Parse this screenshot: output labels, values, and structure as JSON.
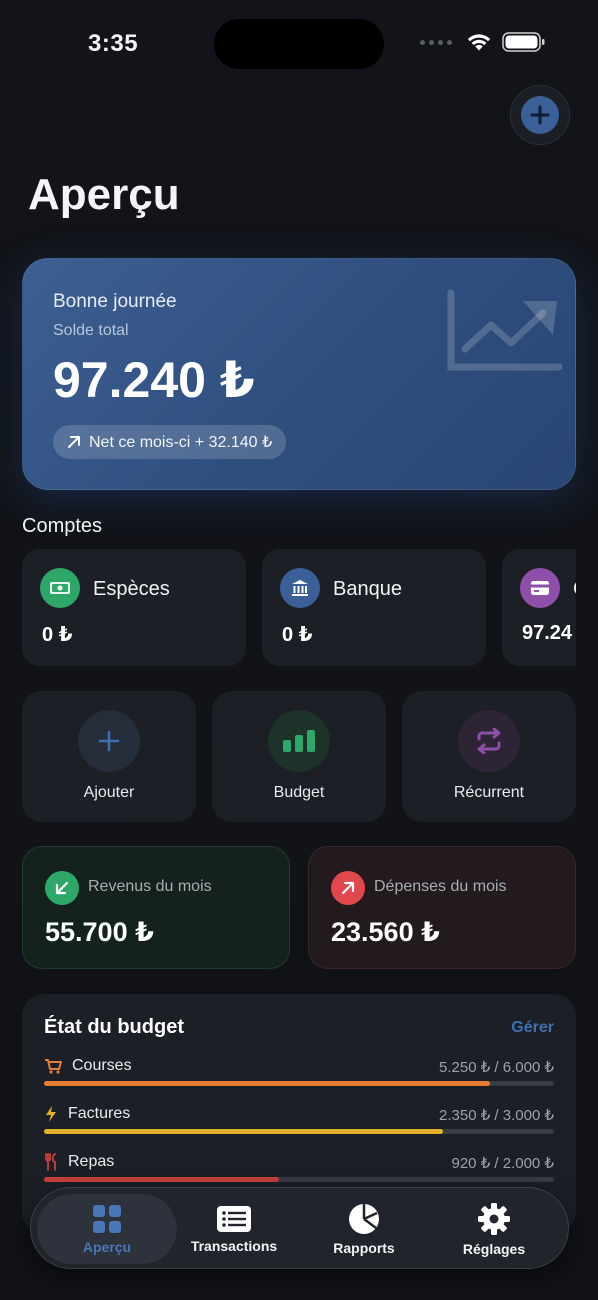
{
  "status": {
    "time": "3:35"
  },
  "header": {
    "title": "Aperçu"
  },
  "balance": {
    "greeting": "Bonne journée",
    "label": "Solde total",
    "value": "97.240 ₺",
    "net": "Net ce mois-ci + 32.140 ₺"
  },
  "accounts": {
    "title": "Comptes",
    "items": [
      {
        "name": "Espèces",
        "balance": "0 ₺",
        "color": "#2ea869"
      },
      {
        "name": "Banque",
        "balance": "0 ₺",
        "color": "#3b5f97"
      },
      {
        "name": "C",
        "balance": "97.24",
        "color": "#8e4fa9"
      }
    ]
  },
  "actions": [
    {
      "label": "Ajouter",
      "icon": "plus-icon"
    },
    {
      "label": "Budget",
      "icon": "bar-chart-icon"
    },
    {
      "label": "Récurrent",
      "icon": "repeat-icon"
    }
  ],
  "monthly": {
    "income": {
      "label": "Revenus du mois",
      "value": "55.700 ₺",
      "color": "#2ea869"
    },
    "expense": {
      "label": "Dépenses du mois",
      "value": "23.560 ₺",
      "color": "#e0484e"
    }
  },
  "budget": {
    "title": "État du budget",
    "manage": "Gérer",
    "items": [
      {
        "name": "Courses",
        "amount": "5.250 ₺ / 6.000 ₺",
        "progress": 0.875,
        "color": "#e77d33",
        "icon": "cart-icon"
      },
      {
        "name": "Factures",
        "amount": "2.350 ₺ / 3.000 ₺",
        "progress": 0.783,
        "color": "#e5b12c",
        "icon": "bolt-icon"
      },
      {
        "name": "Repas",
        "amount": "920 ₺ / 2.000 ₺",
        "progress": 0.46,
        "color": "#c8413d",
        "icon": "fork-knife-icon"
      }
    ]
  },
  "tabbar": {
    "items": [
      {
        "label": "Aperçu",
        "icon": "grid-icon",
        "active": true
      },
      {
        "label": "Transactions",
        "icon": "list-icon",
        "active": false
      },
      {
        "label": "Rapports",
        "icon": "pie-chart-icon",
        "active": false
      },
      {
        "label": "Réglages",
        "icon": "gear-icon",
        "active": false
      }
    ]
  }
}
